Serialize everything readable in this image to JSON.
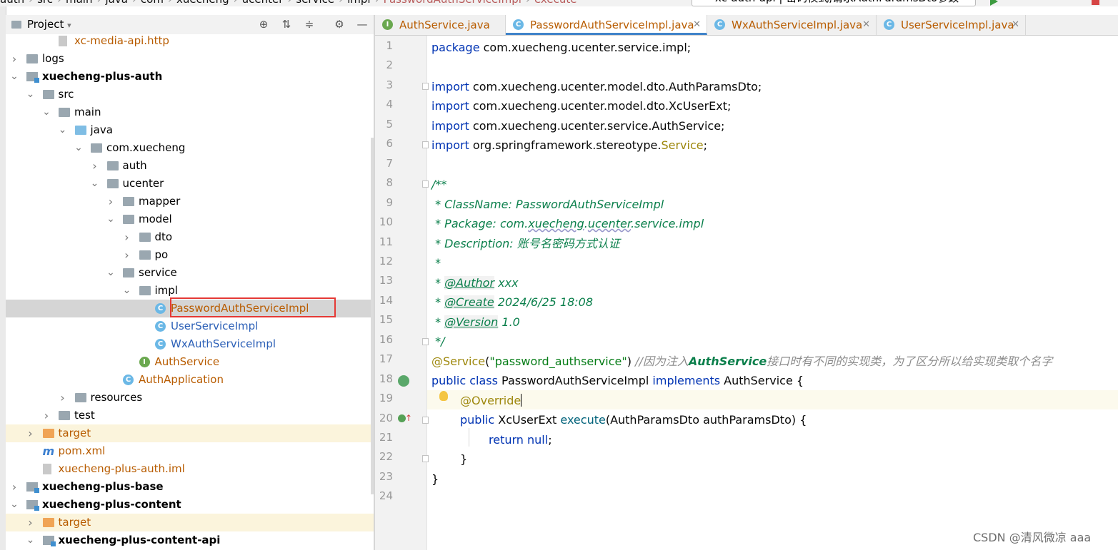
{
  "breadcrumb": [
    "auth",
    "src",
    "main",
    "java",
    "com",
    "xuecheng",
    "ucenter",
    "service",
    "impl",
    "PasswordAuthServiceImpl",
    "execute"
  ],
  "run_config": "xc-auth-api | 密码模式,请求AuthParamsDto参数",
  "project_panel": {
    "title": "Project"
  },
  "tree": [
    {
      "depth": 3,
      "label": "xc-media-api.http",
      "icon": "api-file-icon",
      "expand": "none",
      "style": "orange"
    },
    {
      "depth": 1,
      "label": "logs",
      "icon": "folder-icon",
      "expand": "collapsed",
      "style": "normal"
    },
    {
      "depth": 1,
      "label": "xuecheng-plus-auth",
      "icon": "module-icon",
      "expand": "expanded",
      "style": "bold"
    },
    {
      "depth": 2,
      "label": "src",
      "icon": "folder-icon",
      "expand": "expanded",
      "style": "normal"
    },
    {
      "depth": 3,
      "label": "main",
      "icon": "folder-icon",
      "expand": "expanded",
      "style": "normal"
    },
    {
      "depth": 4,
      "label": "java",
      "icon": "source-folder-icon",
      "expand": "expanded",
      "style": "normal"
    },
    {
      "depth": 5,
      "label": "com.xuecheng",
      "icon": "package-icon",
      "expand": "expanded",
      "style": "normal"
    },
    {
      "depth": 6,
      "label": "auth",
      "icon": "package-icon",
      "expand": "collapsed",
      "style": "normal"
    },
    {
      "depth": 6,
      "label": "ucenter",
      "icon": "package-icon",
      "expand": "expanded",
      "style": "normal"
    },
    {
      "depth": 7,
      "label": "mapper",
      "icon": "package-icon",
      "expand": "collapsed",
      "style": "normal"
    },
    {
      "depth": 7,
      "label": "model",
      "icon": "package-icon",
      "expand": "expanded",
      "style": "normal"
    },
    {
      "depth": 8,
      "label": "dto",
      "icon": "package-icon",
      "expand": "collapsed",
      "style": "normal"
    },
    {
      "depth": 8,
      "label": "po",
      "icon": "package-icon",
      "expand": "collapsed",
      "style": "normal"
    },
    {
      "depth": 7,
      "label": "service",
      "icon": "package-icon",
      "expand": "expanded",
      "style": "normal"
    },
    {
      "depth": 8,
      "label": "impl",
      "icon": "package-icon",
      "expand": "expanded",
      "style": "normal"
    },
    {
      "depth": 9,
      "label": "PasswordAuthServiceImpl",
      "icon": "class-icon",
      "expand": "none",
      "style": "orange",
      "selected": true
    },
    {
      "depth": 9,
      "label": "UserServiceImpl",
      "icon": "class-icon",
      "expand": "none",
      "style": "blue"
    },
    {
      "depth": 9,
      "label": "WxAuthServiceImpl",
      "icon": "class-icon",
      "expand": "none",
      "style": "blue"
    },
    {
      "depth": 8,
      "label": "AuthService",
      "icon": "interface-icon",
      "expand": "none",
      "style": "orange"
    },
    {
      "depth": 7,
      "label": "AuthApplication",
      "icon": "spring-class-icon",
      "expand": "none",
      "style": "orange"
    },
    {
      "depth": 4,
      "label": "resources",
      "icon": "resources-folder-icon",
      "expand": "collapsed",
      "style": "normal"
    },
    {
      "depth": 3,
      "label": "test",
      "icon": "folder-icon",
      "expand": "collapsed",
      "style": "normal"
    },
    {
      "depth": 2,
      "label": "target",
      "icon": "excluded-folder-icon",
      "expand": "collapsed",
      "style": "orange",
      "highlight": true
    },
    {
      "depth": 2,
      "label": "pom.xml",
      "icon": "maven-icon",
      "expand": "none",
      "style": "orange"
    },
    {
      "depth": 2,
      "label": "xuecheng-plus-auth.iml",
      "icon": "iml-file-icon",
      "expand": "none",
      "style": "orange"
    },
    {
      "depth": 1,
      "label": "xuecheng-plus-base",
      "icon": "module-icon",
      "expand": "collapsed",
      "style": "bold"
    },
    {
      "depth": 1,
      "label": "xuecheng-plus-content",
      "icon": "module-icon",
      "expand": "expanded",
      "style": "bold"
    },
    {
      "depth": 2,
      "label": "target",
      "icon": "excluded-folder-icon",
      "expand": "collapsed",
      "style": "orange",
      "highlight": true
    },
    {
      "depth": 2,
      "label": "xuecheng-plus-content-api",
      "icon": "module-icon",
      "expand": "expanded",
      "style": "bold"
    }
  ],
  "tabs": [
    {
      "label": "AuthService.java",
      "icon": "interface-icon",
      "active": false,
      "color": "#b85c00"
    },
    {
      "label": "PasswordAuthServiceImpl.java",
      "icon": "class-icon",
      "active": true,
      "color": "#b85c00"
    },
    {
      "label": "WxAuthServiceImpl.java",
      "icon": "class-icon",
      "active": false,
      "color": "#b85c00"
    },
    {
      "label": "UserServiceImpl.java",
      "icon": "class-icon",
      "active": false,
      "color": "#b85c00"
    }
  ],
  "code": {
    "line_numbers": [
      "1",
      "2",
      "3",
      "4",
      "5",
      "6",
      "7",
      "8",
      "9",
      "10",
      "11",
      "12",
      "13",
      "14",
      "15",
      "16",
      "17",
      "18",
      "19",
      "20",
      "21",
      "22",
      "23",
      "24"
    ],
    "l1_kw": "package",
    "l1_rest": " com.xuecheng.ucenter.service.impl;",
    "l3_kw": "import",
    "l3_rest": " com.xuecheng.ucenter.model.dto.AuthParamsDto;",
    "l4_kw": "import",
    "l4_rest": " com.xuecheng.ucenter.model.dto.XcUserExt;",
    "l5_kw": "import",
    "l5_rest": " com.xuecheng.ucenter.service.AuthService;",
    "l6_kw": "import",
    "l6_rest": " org.springframework.stereotype.",
    "l6_ann": "Service",
    "l6_end": ";",
    "l8": "/**",
    "l9": " * ClassName: PasswordAuthServiceImpl",
    "l10_a": " * Package: com.",
    "l10_b": "xuecheng",
    "l10_c": ".",
    "l10_d": "ucenter",
    "l10_e": ".service.impl",
    "l11": " * Description: 账号名密码方式认证",
    "l12": " *",
    "l13_a": " * ",
    "l13_tag": "@Author",
    "l13_b": " xxx",
    "l14_a": " * ",
    "l14_tag": "@Create",
    "l14_b": " 2024/6/25 18:08",
    "l15_a": " * ",
    "l15_tag": "@Version",
    "l15_b": " 1.0",
    "l16": " */",
    "l17_ann": "@Service",
    "l17_p1": "(",
    "l17_str": "\"password_authservice\"",
    "l17_p2": ") ",
    "l17_cmt_a": "//因为注入",
    "l17_cmt_b": "AuthService",
    "l17_cmt_c": "接口时有不同的实现类，为了区分所以给实现类取个名字",
    "l18_kw1": "public class",
    "l18_name": " PasswordAuthServiceImpl ",
    "l18_kw2": "implements",
    "l18_rest": " AuthService {",
    "l19_ann": "@Override",
    "l20_kw": "public",
    "l20_rest": " XcUserExt ",
    "l20_m": "execute",
    "l20_end": "(AuthParamsDto authParamsDto) {",
    "l21_kw": "return null",
    "l21_end": ";",
    "l22": "}",
    "l23": "}"
  },
  "watermark": "CSDN @清风微凉 aaa"
}
